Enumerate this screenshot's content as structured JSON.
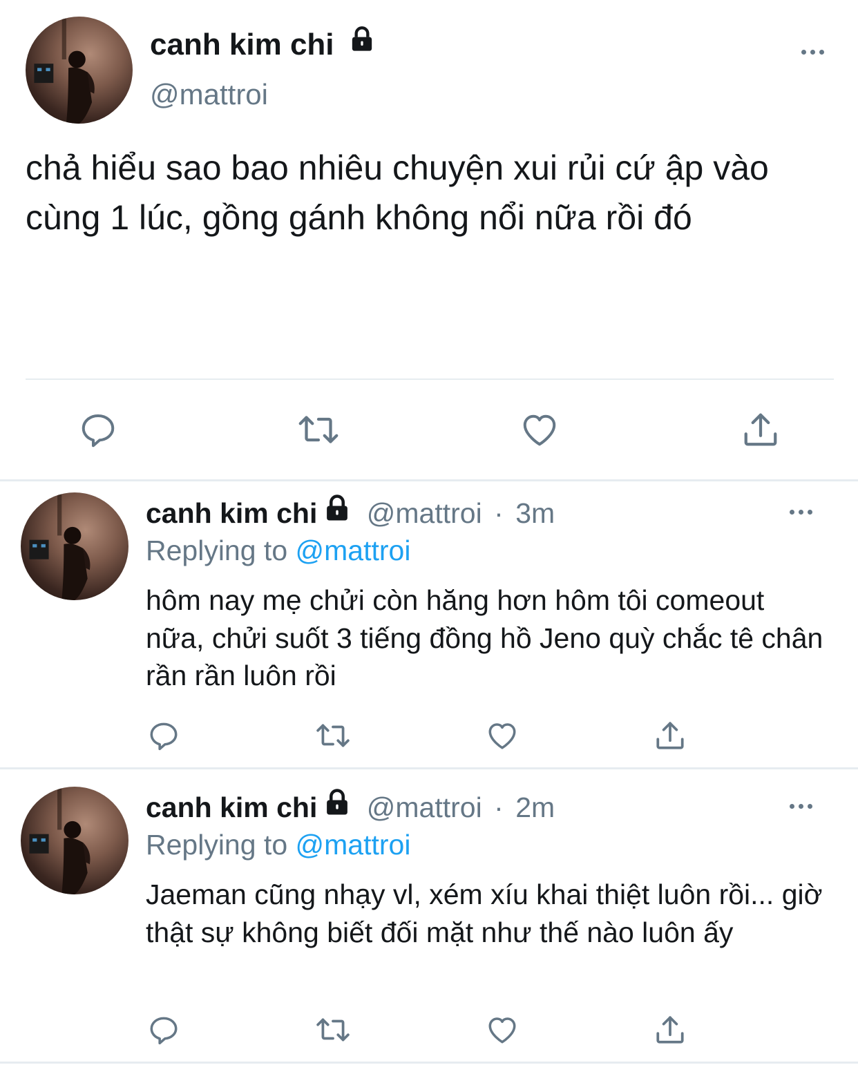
{
  "main_tweet": {
    "author_name": "canh kim chi",
    "author_handle": "@mattroi",
    "text": "chả hiểu sao bao nhiêu chuyện xui rủi cứ ập vào cùng 1 lúc, gồng gánh không nổi nữa rồi đó"
  },
  "replies": [
    {
      "author_name": "canh kim chi",
      "author_handle": "@mattroi",
      "separator": "·",
      "time": "3m",
      "replying_label": "Replying to",
      "replying_to": "@mattroi",
      "text": "hôm nay mẹ chửi còn hăng hơn hôm tôi comeout nữa, chửi suốt 3 tiếng đồng hồ Jeno quỳ chắc tê chân rần rần luôn rồi"
    },
    {
      "author_name": "canh kim chi",
      "author_handle": "@mattroi",
      "separator": "·",
      "time": "2m",
      "replying_label": "Replying to",
      "replying_to": "@mattroi",
      "text": "Jaeman cũng nhạy vl, xém xíu khai thiệt luôn rồi... giờ thật sự không biết đối mặt như thế nào luôn ấy"
    }
  ],
  "icons": {
    "reply": "reply-icon",
    "retweet": "retweet-icon",
    "like": "heart-icon",
    "share": "share-icon",
    "more": "more-icon",
    "protected": "lock-icon"
  },
  "colors": {
    "text": "#14171a",
    "secondary": "#657786",
    "mention": "#1da1f2",
    "divider": "#e6ecf0"
  }
}
